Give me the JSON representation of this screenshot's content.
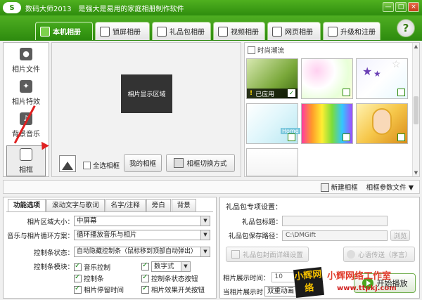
{
  "app": {
    "logo_text": "S",
    "title": "数码大师2013",
    "slogan": "是强大是易用的家庭相册制作软件",
    "window_controls": [
      "—",
      "□",
      "×"
    ]
  },
  "main_tabs": [
    {
      "label": "本机相册",
      "icon": "photo-album-icon",
      "active": true
    },
    {
      "label": "锁屏相册",
      "icon": "monitor-icon",
      "active": false
    },
    {
      "label": "礼品包相册",
      "icon": "gift-icon",
      "active": false
    },
    {
      "label": "视频相册",
      "icon": "film-icon",
      "active": false
    },
    {
      "label": "网页相册",
      "icon": "browser-icon",
      "active": false
    },
    {
      "label": "升级和注册",
      "icon": "gear-icon",
      "active": false
    }
  ],
  "help_label": "?",
  "sidebar": {
    "items": [
      {
        "label": "相片文件",
        "icon": "camera-icon"
      },
      {
        "label": "相片特效",
        "icon": "effects-icon"
      },
      {
        "label": "背景音乐",
        "icon": "music-note-icon"
      },
      {
        "label": "相框",
        "icon": "frame-icon",
        "active": true
      }
    ]
  },
  "preview": {
    "box_label": "相片显示区域",
    "select_all_label": "全选相框",
    "my_frames_label": "我的相框",
    "switch_mode_label": "相框切换方式"
  },
  "gallery": {
    "header_label": "时尚潮流",
    "applied_label": "已应用",
    "applied_mark": "✓",
    "warn_mark": "!",
    "thumb_text_home": "Home"
  },
  "gallery_footer": {
    "new_frame_label": "新建相框",
    "frame_params_label": "相框参数文件",
    "dropdown_mark": "▼"
  },
  "sub_tabs": [
    {
      "label": "功能选项",
      "active": true
    },
    {
      "label": "滚动文字与歌词",
      "active": false
    },
    {
      "label": "名字/注释",
      "active": false
    },
    {
      "label": "旁白",
      "active": false
    },
    {
      "label": "背景",
      "active": false
    }
  ],
  "options": {
    "area_size_label": "相片区域大小：",
    "area_size_value": "中屏幕",
    "loop_label": "音乐与相片循环方案：",
    "loop_value": "循环播放音乐与相片",
    "control_bar_label": "控制条状态：",
    "control_bar_value": "自动隐藏控制条（鼠标移到顶部自动弹出）",
    "control_module_label": "控制条模块：",
    "checks": {
      "music_control": "音乐控制",
      "digital_style": "数字式",
      "control_bar": "控制条",
      "control_status_btn": "控制条状态按钮",
      "photo_pause_time": "相片停留时间",
      "photo_effect_btn": "相片效果开关按钮"
    }
  },
  "gift_panel": {
    "title": "礼品包专项设置：",
    "package_title_label": "礼品包标题：",
    "package_title_value": "",
    "save_path_label": "礼品包保存路径：",
    "save_path_value": "C:\\DMGift",
    "browse_label": "浏览",
    "detail_settings_label": "礼品包封面详细设置",
    "wish_label": "心语传送（序言）",
    "display_time_label": "相片展示时间：",
    "display_time_value": "10",
    "current_display_label": "当相片展示时",
    "current_display_value": "双重动画",
    "play_label": "开始播放"
  },
  "watermark": {
    "logo_text": "小辉网络",
    "title": "小辉网络工作室",
    "url": "www.ttpkj.com"
  },
  "colors": {
    "brand_green": "#2f8d0e",
    "accent_red": "#e02020"
  }
}
